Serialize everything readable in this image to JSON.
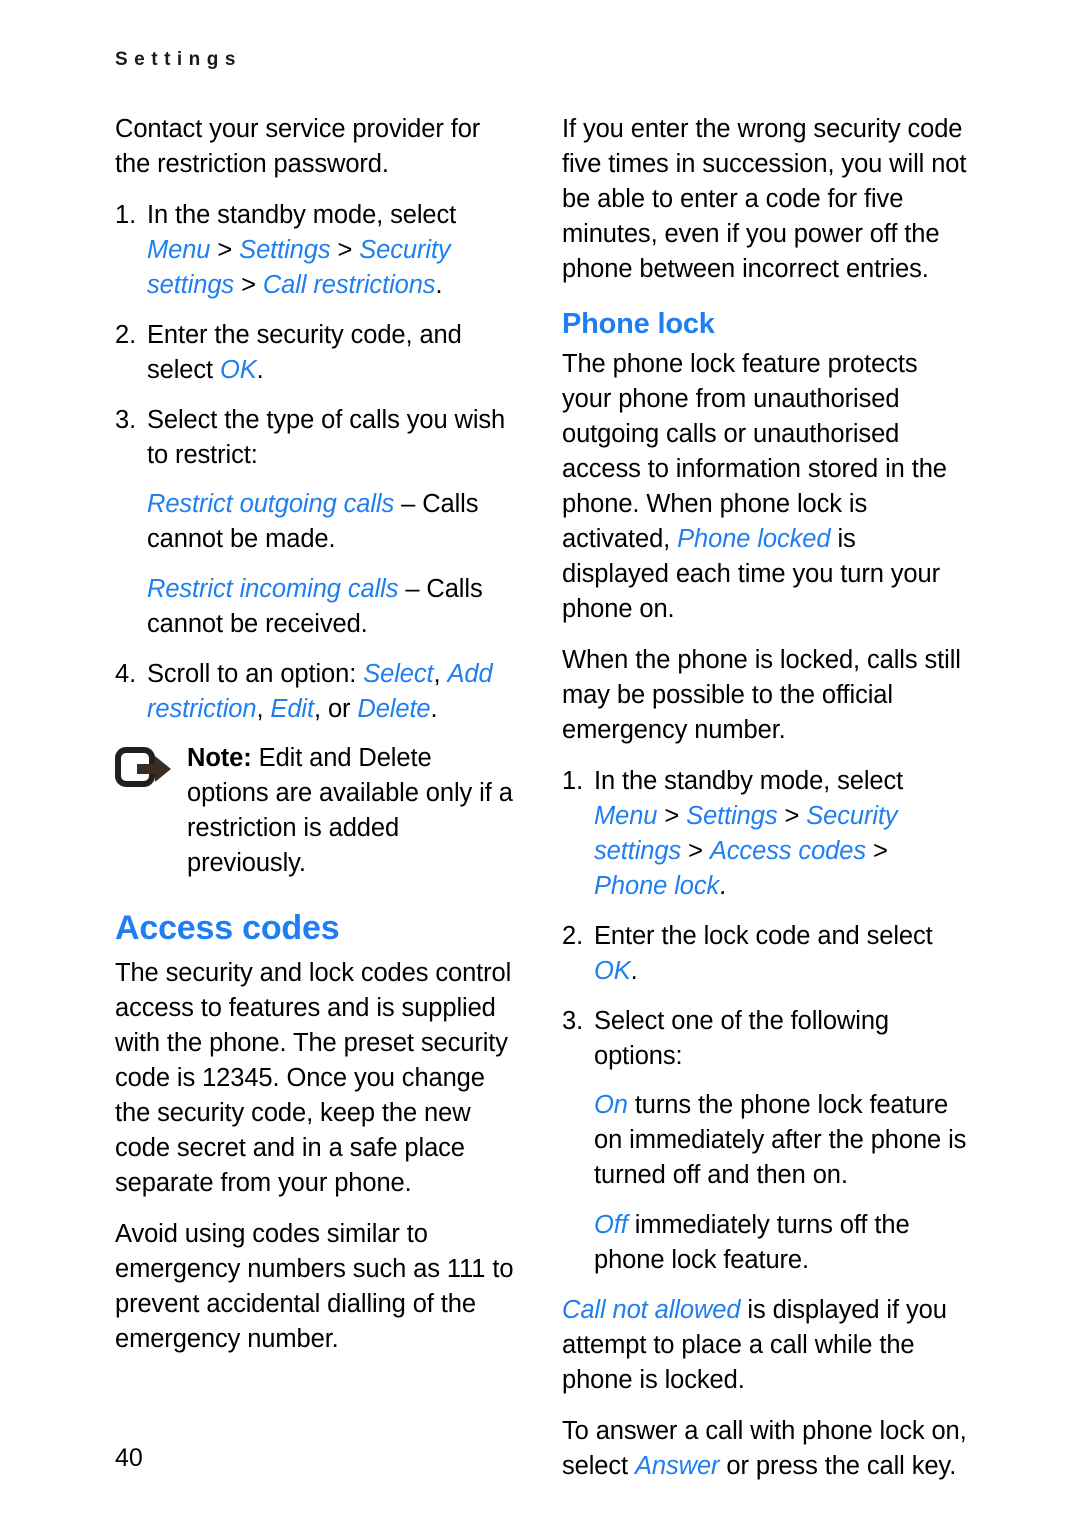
{
  "document": {
    "running_header": "Settings",
    "page_number": "40",
    "accent_color": "#1f7ff0",
    "text_color": "#000000"
  },
  "left_column": {
    "intro_paragraph": "Contact your service provider for the restriction password.",
    "steps": [
      {
        "number": "1.",
        "segments": [
          {
            "text": "In the standby mode, select ",
            "style": "plain"
          },
          {
            "text": "Menu",
            "style": "ui"
          },
          {
            "text": " > ",
            "style": "plain"
          },
          {
            "text": "Settings",
            "style": "ui"
          },
          {
            "text": " > ",
            "style": "plain"
          },
          {
            "text": "Security settings",
            "style": "ui"
          },
          {
            "text": " > ",
            "style": "plain"
          },
          {
            "text": "Call restrictions",
            "style": "ui"
          },
          {
            "text": ".",
            "style": "plain"
          }
        ]
      },
      {
        "number": "2.",
        "segments": [
          {
            "text": "Enter the security code, and select ",
            "style": "plain"
          },
          {
            "text": "OK",
            "style": "ui"
          },
          {
            "text": ".",
            "style": "plain"
          }
        ]
      },
      {
        "number": "3.",
        "segments": [
          {
            "text": "Select the type of calls you wish to restrict:",
            "style": "plain"
          }
        ]
      }
    ],
    "restriction_options": [
      {
        "segments": [
          {
            "text": "Restrict outgoing calls",
            "style": "ui"
          },
          {
            "text": " – Calls cannot be made.",
            "style": "plain"
          }
        ]
      },
      {
        "segments": [
          {
            "text": "Restrict incoming calls",
            "style": "ui"
          },
          {
            "text": " – Calls cannot be received.",
            "style": "plain"
          }
        ]
      }
    ],
    "step_four": {
      "number": "4.",
      "segments": [
        {
          "text": "Scroll to an option: ",
          "style": "plain"
        },
        {
          "text": "Select",
          "style": "ui"
        },
        {
          "text": ", ",
          "style": "plain"
        },
        {
          "text": "Add restriction",
          "style": "ui"
        },
        {
          "text": ", ",
          "style": "plain"
        },
        {
          "text": "Edit",
          "style": "ui"
        },
        {
          "text": ", or ",
          "style": "plain"
        },
        {
          "text": "Delete",
          "style": "ui"
        },
        {
          "text": ".",
          "style": "plain"
        }
      ]
    },
    "note": {
      "icon": "note-arrow-icon",
      "label": "Note:",
      "body": " Edit and Delete options are available only if a restriction is added previously."
    },
    "access_codes": {
      "heading": "Access codes",
      "paragraphs": [
        "The security and lock codes control access to features and is supplied with the phone. The preset security code is 12345. Once you change the security code, keep the new code secret and in a safe place separate from your phone.",
        "Avoid using codes similar to emergency numbers such as 111 to prevent accidental dialling of the emergency number."
      ]
    }
  },
  "right_column": {
    "intro_paragraph": "If you enter the wrong security code five times in succession, you will not be able to enter a code for five minutes, even if you power off the phone between incorrect entries.",
    "phone_lock": {
      "heading": "Phone lock",
      "intro_segments": [
        {
          "text": "The phone lock feature protects your phone from unauthorised outgoing calls or unauthorised access to information stored in the phone. When phone lock is activated, ",
          "style": "plain"
        },
        {
          "text": "Phone locked",
          "style": "ui"
        },
        {
          "text": " is displayed each time you turn your phone on.",
          "style": "plain"
        }
      ],
      "emergency_paragraph": "When the phone is locked, calls still may be possible to the official emergency number.",
      "steps": [
        {
          "number": "1.",
          "segments": [
            {
              "text": "In the standby mode, select ",
              "style": "plain"
            },
            {
              "text": "Menu",
              "style": "ui"
            },
            {
              "text": " > ",
              "style": "plain"
            },
            {
              "text": "Settings",
              "style": "ui"
            },
            {
              "text": " > ",
              "style": "plain"
            },
            {
              "text": "Security settings",
              "style": "ui"
            },
            {
              "text": " > ",
              "style": "plain"
            },
            {
              "text": "Access codes",
              "style": "ui"
            },
            {
              "text": " > ",
              "style": "plain"
            },
            {
              "text": "Phone lock",
              "style": "ui"
            },
            {
              "text": ".",
              "style": "plain"
            }
          ]
        },
        {
          "number": "2.",
          "segments": [
            {
              "text": "Enter the lock code and select ",
              "style": "plain"
            },
            {
              "text": "OK",
              "style": "ui"
            },
            {
              "text": ".",
              "style": "plain"
            }
          ]
        },
        {
          "number": "3.",
          "segments": [
            {
              "text": "Select one of the following options:",
              "style": "plain"
            }
          ]
        }
      ],
      "lock_options": [
        {
          "segments": [
            {
              "text": "On",
              "style": "ui"
            },
            {
              "text": " turns the phone lock feature on immediately after the phone is turned off and then on.",
              "style": "plain"
            }
          ]
        },
        {
          "segments": [
            {
              "text": "Off",
              "style": "ui"
            },
            {
              "text": " immediately turns off the phone lock feature.",
              "style": "plain"
            }
          ]
        }
      ],
      "closing_paragraphs": [
        {
          "segments": [
            {
              "text": "Call not allowed",
              "style": "ui"
            },
            {
              "text": " is displayed if you attempt to place a call while the phone is locked.",
              "style": "plain"
            }
          ]
        },
        {
          "segments": [
            {
              "text": "To answer a call with phone lock on, select ",
              "style": "plain"
            },
            {
              "text": "Answer",
              "style": "ui"
            },
            {
              "text": " or press the call key.",
              "style": "plain"
            }
          ]
        }
      ]
    }
  }
}
